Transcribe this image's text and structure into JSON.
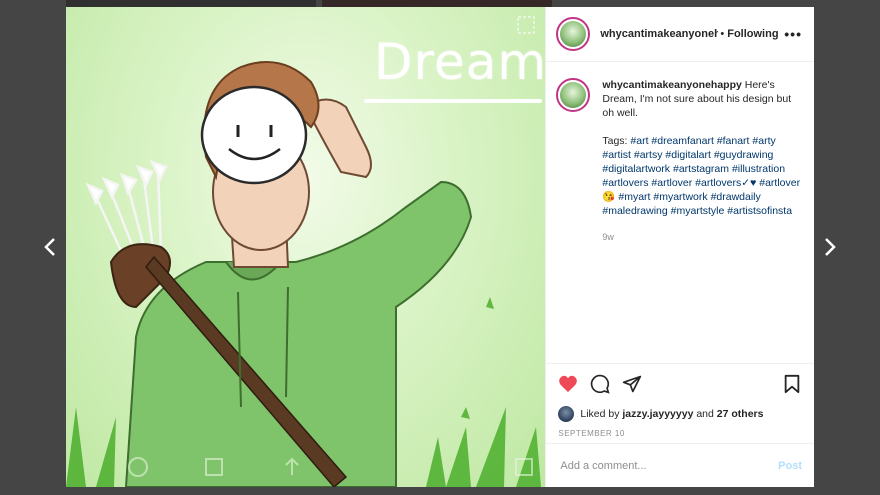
{
  "background": {
    "overlay_color": "#000000"
  },
  "post": {
    "image": {
      "title_text": "Dream"
    },
    "header": {
      "username": "whycantimakeanyonehappy",
      "separator": "•",
      "follow_status": "Following",
      "more_icon": "more-options-icon"
    },
    "caption": {
      "username": "whycantimakeanyonehappy",
      "text": "Here's Dream, I'm not sure about his design but oh well.",
      "tags_label": "Tags:",
      "tags": [
        "#art",
        "#dreamfanart",
        "#fanart",
        "#arty",
        "#artist",
        "#artsy",
        "#digitalart",
        "#guydrawing",
        "#digitalartwork",
        "#artstagram",
        "#illustration",
        "#artlovers",
        "#artlover",
        "#artlovers✓♥",
        "#artlover😘",
        "#myart",
        "#myartwork",
        "#drawdaily",
        "#maledrawing",
        "#myartstyle",
        "#artistsofinsta"
      ],
      "time": "9w"
    },
    "actions": {
      "like_icon": "heart-icon",
      "comment_icon": "comment-icon",
      "share_icon": "share-icon",
      "save_icon": "bookmark-icon",
      "like_color": "#ed4956"
    },
    "likes": {
      "prefix": "Liked by",
      "user": "jazzy.jayyyyyy",
      "and_text": "and",
      "others": "27 others"
    },
    "date": "SEPTEMBER 10",
    "comment": {
      "placeholder": "Add a comment...",
      "post_label": "Post",
      "post_color": "#b2dffc"
    }
  },
  "nav": {
    "prev_icon": "chevron-left-icon",
    "next_icon": "chevron-right-icon"
  }
}
